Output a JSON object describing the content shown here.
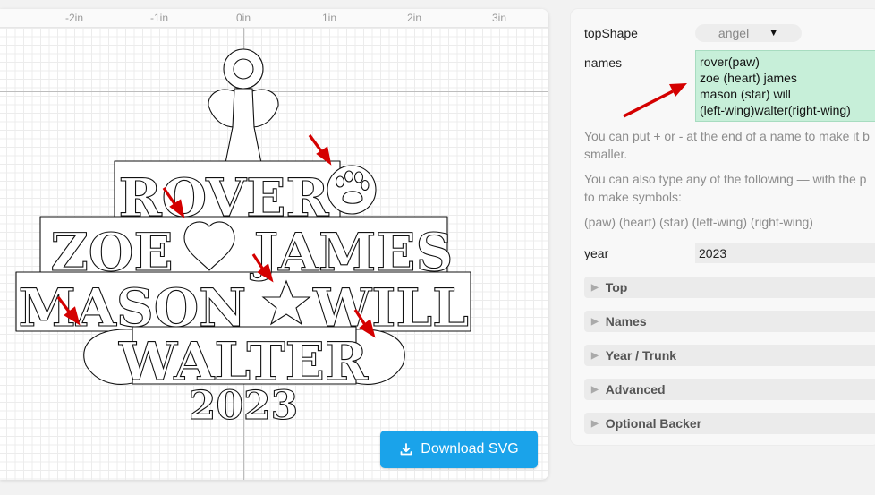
{
  "ruler": {
    "labels": [
      "-2in",
      "-1in",
      "0in",
      "1in",
      "2in",
      "3in"
    ]
  },
  "design": {
    "names_lines": [
      "ROVER",
      "ZOE",
      "JAMES",
      "MASON",
      "WILL",
      "WALTER"
    ],
    "year": "2023"
  },
  "download": {
    "label": "Download SVG",
    "icon": "download-icon"
  },
  "settings": {
    "top_shape": {
      "label": "topShape",
      "value": "angel"
    },
    "names": {
      "label": "names",
      "lines": [
        "rover(paw)",
        "zoe (heart) james",
        "mason (star) will",
        "(left-wing)walter(right-wing)"
      ]
    },
    "help": {
      "line1": "You can put + or - at the end of a name to make it b",
      "line2": "smaller.",
      "line3": "You can also type any of the following — with the p",
      "line4": "to make symbols:",
      "symbols": "(paw) (heart) (star) (left-wing) (right-wing)"
    },
    "year": {
      "label": "year",
      "value": "2023"
    },
    "sections": [
      "Top",
      "Names",
      "Year / Trunk",
      "Advanced",
      "Optional Backer"
    ]
  },
  "colors": {
    "accent": "#1aa3ea",
    "highlight": "#c7efd9",
    "arrow": "#d40000"
  }
}
